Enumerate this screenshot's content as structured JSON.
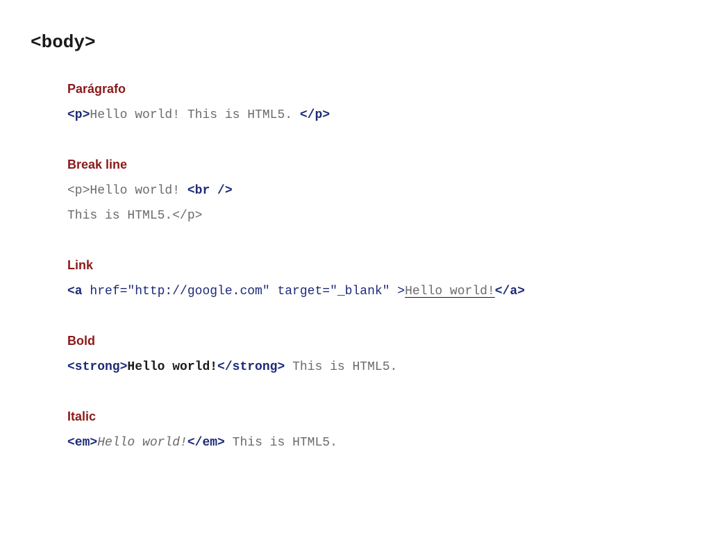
{
  "title": "<body>",
  "sections": {
    "paragraph": {
      "heading": "Parágrafo",
      "line1": {
        "open": "<p>",
        "text": "Hello world! This is HTML5. ",
        "close": "</p>"
      }
    },
    "breakline": {
      "heading": "Break line",
      "line1": {
        "open": "<p>",
        "text": "Hello world! ",
        "br": "<br />"
      },
      "line2": {
        "text": "This is HTML5.",
        "close": "</p>"
      }
    },
    "link": {
      "heading": "Link",
      "line1": {
        "open_a": "<a",
        "attrs": " href=\"http://google.com\" target=\"_blank\" ",
        "open_end": ">",
        "text": "Hello world!",
        "close": "</a>"
      }
    },
    "bold": {
      "heading": "Bold",
      "line1": {
        "open": "<strong>",
        "text": "Hello world!",
        "close": "</strong>",
        "after": " This is HTML5."
      }
    },
    "italic": {
      "heading": "Italic",
      "line1": {
        "open": "<em>",
        "text": "Hello world!",
        "close": "</em>",
        "after": " This is HTML5."
      }
    }
  }
}
